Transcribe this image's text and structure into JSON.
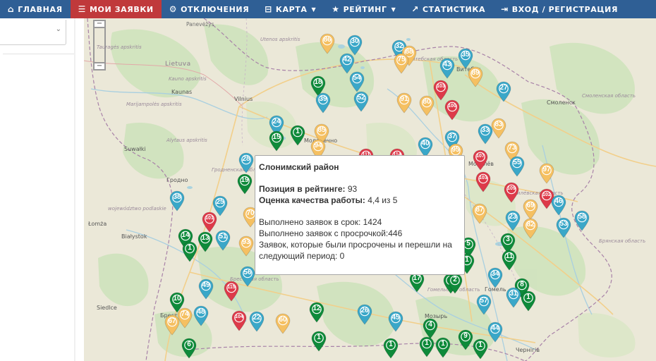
{
  "nav": {
    "items": [
      {
        "label": "ГЛАВНАЯ",
        "icon": "home-icon",
        "glyph": "⌂",
        "active": false,
        "dropdown": false
      },
      {
        "label": "МОИ ЗАЯВКИ",
        "icon": "list-icon",
        "glyph": "☰",
        "active": true,
        "dropdown": false
      },
      {
        "label": "ОТКЛЮЧЕНИЯ",
        "icon": "gear-icon",
        "glyph": "⚙",
        "active": false,
        "dropdown": false
      },
      {
        "label": "КАРТА",
        "icon": "map-icon",
        "glyph": "⊟",
        "active": false,
        "dropdown": true
      },
      {
        "label": "РЕЙТИНГ",
        "icon": "star-icon",
        "glyph": "★",
        "active": false,
        "dropdown": true
      },
      {
        "label": "СТАТИСТИКА",
        "icon": "chart-icon",
        "glyph": "↗",
        "active": false,
        "dropdown": false
      },
      {
        "label": "ВХОД / РЕГИСТРАЦИЯ",
        "icon": "login-icon",
        "glyph": "⇥",
        "active": false,
        "dropdown": false
      }
    ]
  },
  "colors": {
    "nav_bg": "#2f5f95",
    "nav_active": "#c0393b",
    "marker_green": "#0e8a3a",
    "marker_teal": "#3aa7c8",
    "marker_yellow": "#f5c062",
    "marker_red": "#dd3a4a"
  },
  "map": {
    "labels": {
      "panevezys": "Panevėžys",
      "utenos": "Utenos apskritis",
      "lietuva": "Lietuva",
      "taurages": "Tauragės apskritis",
      "kauno": "Kauno apskritis",
      "kaunas": "Kaunas",
      "vilnius": "Vilnius",
      "marijampoles": "Marijampolės apskritis",
      "alytaus": "Alytaus apskritis",
      "suwalki": "Suwałki",
      "podlaskie": "województwo podlaskie",
      "lomza": "Łomża",
      "bialystok": "Białystok",
      "siedlce": "Siedlce",
      "smolensk": "Смоленск",
      "smolensk_obl": "Смоленская область",
      "bryansk_obl": "Брянская область",
      "mogilev_obl": "Могилёвская область",
      "gomel_obl": "Гомельская область",
      "grodno_obl": "Гродненская область",
      "brest_obl": "Брестская область",
      "vitebsk_obl": "Витебская область",
      "molodechno": "Молодечно",
      "grodno": "Гродно",
      "vitebsk": "Витебск",
      "gomel": "Гомель",
      "chernigov": "Чернігів",
      "mogilev": "Могилёв",
      "brest": "Брест",
      "mozyr": "Мозырь"
    },
    "markers": [
      {
        "n": "86",
        "c": "yellow"
      },
      {
        "n": "30",
        "c": "teal"
      },
      {
        "n": "32",
        "c": "teal"
      },
      {
        "n": "88",
        "c": "yellow"
      },
      {
        "n": "35",
        "c": "teal"
      },
      {
        "n": "42",
        "c": "teal"
      },
      {
        "n": "75",
        "c": "yellow"
      },
      {
        "n": "43",
        "c": "teal"
      },
      {
        "n": "89",
        "c": "yellow"
      },
      {
        "n": "18",
        "c": "green"
      },
      {
        "n": "54",
        "c": "teal"
      },
      {
        "n": "103",
        "c": "red"
      },
      {
        "n": "27",
        "c": "teal"
      },
      {
        "n": "39",
        "c": "teal"
      },
      {
        "n": "52",
        "c": "teal"
      },
      {
        "n": "91",
        "c": "yellow"
      },
      {
        "n": "80",
        "c": "yellow"
      },
      {
        "n": "100",
        "c": "red"
      },
      {
        "n": "24",
        "c": "teal"
      },
      {
        "n": "1",
        "c": "green"
      },
      {
        "n": "85",
        "c": "yellow"
      },
      {
        "n": "15",
        "c": "green"
      },
      {
        "n": "33",
        "c": "teal"
      },
      {
        "n": "83",
        "c": "yellow"
      },
      {
        "n": "37",
        "c": "teal"
      },
      {
        "n": "94",
        "c": "yellow"
      },
      {
        "n": "40",
        "c": "teal"
      },
      {
        "n": "95",
        "c": "yellow"
      },
      {
        "n": "73",
        "c": "yellow"
      },
      {
        "n": "28",
        "c": "teal"
      },
      {
        "n": "78",
        "c": "yellow"
      },
      {
        "n": "113",
        "c": "red"
      },
      {
        "n": "111",
        "c": "red"
      },
      {
        "n": "99",
        "c": "yellow"
      },
      {
        "n": "114",
        "c": "red"
      },
      {
        "n": "107",
        "c": "red"
      },
      {
        "n": "55",
        "c": "teal"
      },
      {
        "n": "97",
        "c": "yellow"
      },
      {
        "n": "19",
        "c": "green"
      },
      {
        "n": "103",
        "c": "red"
      },
      {
        "n": "109",
        "c": "red"
      },
      {
        "n": "102",
        "c": "red"
      },
      {
        "n": "38",
        "c": "teal"
      },
      {
        "n": "25",
        "c": "teal"
      },
      {
        "n": "69",
        "c": "yellow"
      },
      {
        "n": "46",
        "c": "teal"
      },
      {
        "n": "87",
        "c": "yellow"
      },
      {
        "n": "70",
        "c": "yellow"
      },
      {
        "n": "101",
        "c": "red"
      },
      {
        "n": "23",
        "c": "teal"
      },
      {
        "n": "58",
        "c": "teal"
      },
      {
        "n": "82",
        "c": "yellow"
      },
      {
        "n": "53",
        "c": "teal"
      },
      {
        "n": "14",
        "c": "green"
      },
      {
        "n": "13",
        "c": "green"
      },
      {
        "n": "51",
        "c": "teal"
      },
      {
        "n": "93",
        "c": "yellow"
      },
      {
        "n": "1",
        "c": "green"
      },
      {
        "n": "3",
        "c": "green"
      },
      {
        "n": "5",
        "c": "green"
      },
      {
        "n": "1",
        "c": "green"
      },
      {
        "n": "11",
        "c": "green"
      },
      {
        "n": "56",
        "c": "teal"
      },
      {
        "n": "34",
        "c": "teal"
      },
      {
        "n": "17",
        "c": "green"
      },
      {
        "n": "7",
        "c": "green"
      },
      {
        "n": "2",
        "c": "green"
      },
      {
        "n": "8",
        "c": "green"
      },
      {
        "n": "49",
        "c": "teal"
      },
      {
        "n": "115",
        "c": "red"
      },
      {
        "n": "31",
        "c": "teal"
      },
      {
        "n": "1",
        "c": "green"
      },
      {
        "n": "10",
        "c": "green"
      },
      {
        "n": "57",
        "c": "teal"
      },
      {
        "n": "12",
        "c": "green"
      },
      {
        "n": "74",
        "c": "yellow"
      },
      {
        "n": "48",
        "c": "teal"
      },
      {
        "n": "104",
        "c": "red"
      },
      {
        "n": "22",
        "c": "teal"
      },
      {
        "n": "26",
        "c": "teal"
      },
      {
        "n": "45",
        "c": "teal"
      },
      {
        "n": "67",
        "c": "yellow"
      },
      {
        "n": "60",
        "c": "yellow"
      },
      {
        "n": "4",
        "c": "green"
      },
      {
        "n": "44",
        "c": "teal"
      },
      {
        "n": "9",
        "c": "green"
      },
      {
        "n": "1",
        "c": "green"
      },
      {
        "n": "1",
        "c": "green"
      },
      {
        "n": "6",
        "c": "green"
      },
      {
        "n": "1",
        "c": "green"
      },
      {
        "n": "1",
        "c": "green"
      },
      {
        "n": "1",
        "c": "green"
      }
    ]
  },
  "popup": {
    "title": "Слонимский район",
    "rank_label": "Позиция в рейтинге:",
    "rank_value": "93",
    "quality_label": "Оценка качества работы:",
    "quality_value": "4,4 из 5",
    "on_time": "Выполнено заявок в срок: 1424",
    "late": "Выполнено заявок с просрочкой:446",
    "carried_1": "Заявок, которые были просрочены и перешли на",
    "carried_2": "следующий период: 0"
  }
}
